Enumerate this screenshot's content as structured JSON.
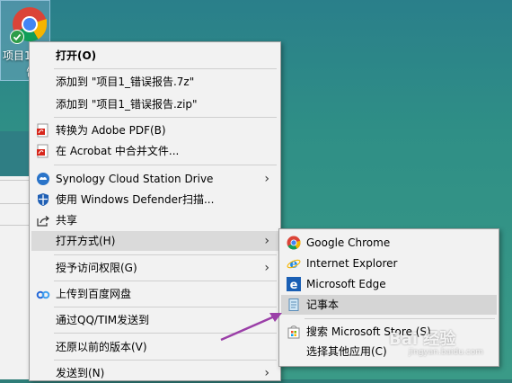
{
  "desktop": {
    "icon_label_line1": "项目1",
    "icon_label_line2": "告"
  },
  "context_menu": {
    "items": [
      {
        "label": "打开(O)"
      },
      {
        "label": "添加到 \"项目1_错误报告.7z\""
      },
      {
        "label": "添加到 \"项目1_错误报告.zip\""
      },
      {
        "label": "转换为 Adobe PDF(B)"
      },
      {
        "label": "在 Acrobat 中合并文件..."
      },
      {
        "label": "Synology Cloud Station Drive"
      },
      {
        "label": "使用 Windows Defender扫描..."
      },
      {
        "label": "共享"
      },
      {
        "label": "打开方式(H)"
      },
      {
        "label": "授予访问权限(G)"
      },
      {
        "label": "上传到百度网盘"
      },
      {
        "label": "通过QQ/TIM发送到"
      },
      {
        "label": "还原以前的版本(V)"
      },
      {
        "label": "发送到(N)"
      }
    ]
  },
  "open_with_submenu": {
    "items": [
      {
        "label": "Google Chrome"
      },
      {
        "label": "Internet Explorer"
      },
      {
        "label": "Microsoft Edge"
      },
      {
        "label": "记事本"
      },
      {
        "label": "搜索 Microsoft Store (S)"
      },
      {
        "label": "选择其他应用(C)"
      }
    ]
  },
  "watermark": {
    "text": "Bai 经验",
    "sub": "jingyan.baidu.com"
  },
  "icons": [
    "chrome-icon",
    "adobe-pdf-icon",
    "synology-icon",
    "defender-shield-icon",
    "share-icon",
    "baidu-netdisk-icon",
    "ie-icon",
    "edge-icon",
    "notepad-icon",
    "store-icon"
  ],
  "colors": {
    "menu_bg": "#f2f2f2",
    "highlight": "#dadada",
    "annotation_arrow": "#9b3fa8"
  }
}
